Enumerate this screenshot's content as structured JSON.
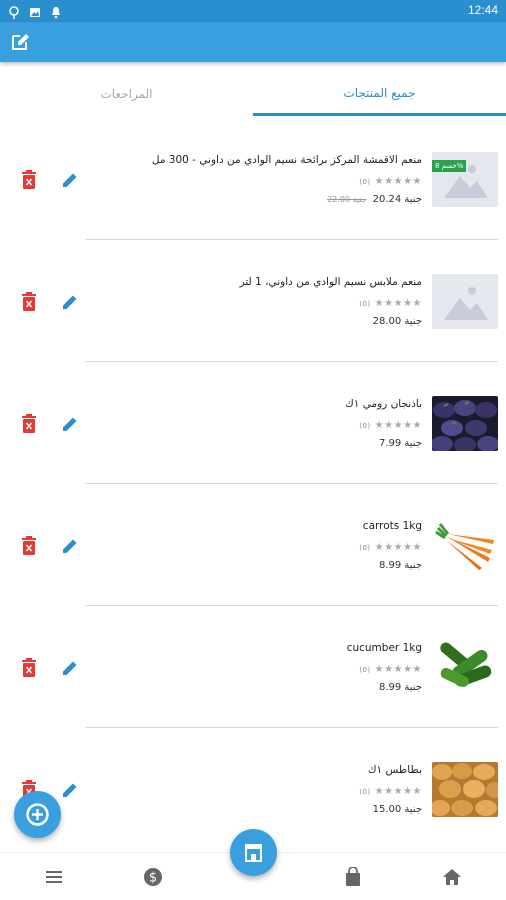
{
  "status_bar": {
    "time": "12:44"
  },
  "tabs": {
    "all_products": "جميع المنتجات",
    "reviews": "المراجعات"
  },
  "products": [
    {
      "name": "منعم الاقمشة المركز برائحة نسيم الوادي من داوني - 300 مل",
      "rating_count": "(0)",
      "price": "20.24 جنية",
      "old_price": "22.00 جنية",
      "badge": "خصم 8%",
      "image": "placeholder-image"
    },
    {
      "name": "منعم ملابس نسيم الوادي من داوني، 1 لتر",
      "rating_count": "(0)",
      "price": "28.00 جنية",
      "image": "placeholder-image"
    },
    {
      "name": "باذنجان رومي ١ك",
      "rating_count": "(0)",
      "price": "7.99 جنية",
      "image": "eggplant-photo"
    },
    {
      "name": "carrots 1kg",
      "rating_count": "(0)",
      "price": "8.99 جنية",
      "image": "carrots-photo"
    },
    {
      "name": "cucumber 1kg",
      "rating_count": "(0)",
      "price": "8.99 جنية",
      "image": "cucumber-photo"
    },
    {
      "name": "بطاطس ١ك",
      "rating_count": "(0)",
      "price": "15.00 جنية",
      "image": "potatoes-photo"
    }
  ],
  "stars": "★★★★★",
  "colors": {
    "primary": "#3a9fdf",
    "delete": "#e53935",
    "edit": "#2a8fce",
    "badge": "#2aa34a"
  },
  "bottom_nav": [
    "menu-icon",
    "dollar-icon",
    "store-icon",
    "bag-icon",
    "home-icon"
  ]
}
